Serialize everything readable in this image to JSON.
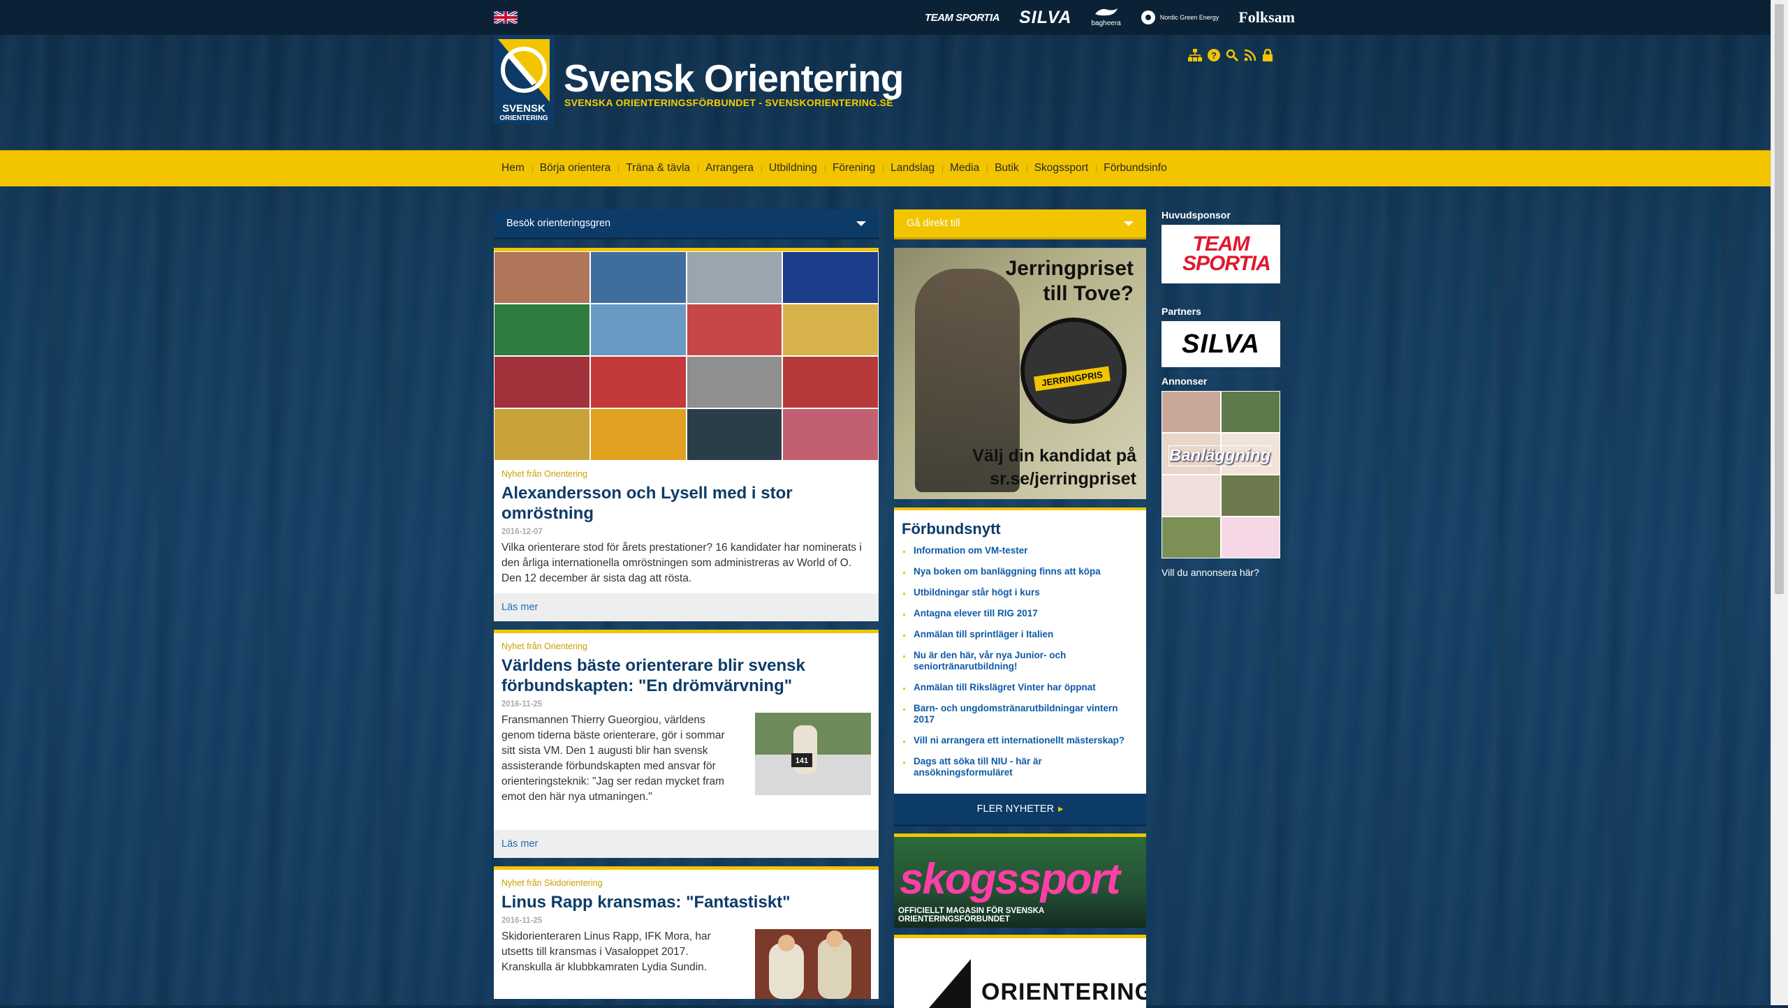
{
  "header": {
    "logo_title": "Svensk Orientering",
    "logo_subtitle": "SVENSKA ORIENTERINGSFÖRBUNDET - SVENSKORIENTERING.SE",
    "logo_box_text": "SVENSK ORIENTERING",
    "sponsors": [
      "TEAM SPORTIA",
      "SILVA",
      "bagheera",
      "Nordic Green Energy",
      "Folksam"
    ],
    "tools": [
      "sitemap-icon",
      "help-icon",
      "search-icon",
      "rss-icon",
      "lock-icon"
    ]
  },
  "nav": {
    "items": [
      "Hem",
      "Börja orientera",
      "Träna & tävla",
      "Arrangera",
      "Utbildning",
      "Förening",
      "Landslag",
      "Media",
      "Butik",
      "Skogssport",
      "Förbundsinfo"
    ]
  },
  "left": {
    "dropdown": "Besök orienteringsgren",
    "articles": [
      {
        "source": "Nyhet från Orientering",
        "title": "Alexandersson och Lysell med i stor omröstning",
        "date": "2016-12-07",
        "body": "Vilka orienterare stod för årets prestationer? 16 kandidater har nominerats i den årliga internationella omröstningen som administreras av World of O. Den 12 december är sista dag att rösta.",
        "more": "Läs mer"
      },
      {
        "source": "Nyhet från Orientering",
        "title": "Världens bäste orienterare blir svensk förbundskapten: \"En drömvärvning\"",
        "date": "2016-11-25",
        "body": "Fransmannen Thierry Gueorgiou, världens genom tiderna bäste orienterare, gör i sommar sitt sista VM. Den 1 augusti blir han svensk assisterande förbundskapten med ansvar för orienteringsteknik: \"Jag ser redan mycket fram emot den här nya utmaningen.\"",
        "more": "Läs mer"
      },
      {
        "source": "Nyhet från Skidorientering",
        "title": "Linus Rapp kransmas: \"Fantastiskt\"",
        "date": "2016-11-25",
        "body": "Skidorienteraren Linus Rapp, IFK Mora, har utsetts till kransmas i Vasaloppet 2017. Kranskulla är klubbkamraten Lydia Sundin."
      }
    ]
  },
  "middle": {
    "dropdown": "Gå direkt till",
    "banner": {
      "line1": "Jerringpriset",
      "line2": "till Tove?",
      "badge": "JERRINGPRIS",
      "line3": "Välj din kandidat på",
      "line4": "sr.se/jerringpriset"
    },
    "news": {
      "title": "Förbundsnytt",
      "items": [
        "Information om VM-tester",
        "Nya boken om banläggning finns att köpa",
        "Utbildningar står högt i kurs",
        "Antagna elever till RIG 2017",
        "Anmälan till sprintläger i Italien",
        "Nu är den här, vår nya Junior- och seniortränarutbildning!",
        "Anmälan till Rikslägret Vinter har öppnat",
        "Barn- och ungdomstränarutbildningar vintern 2017",
        "Vill ni arrangera ett internationellt mästerskap?",
        "Dags att söka till NIU - här är ansökningsformuläret"
      ],
      "more": "FLER NYHETER"
    },
    "skogssport": {
      "brand": "skogssport",
      "caption": "OFFICIELLT MAGASIN FÖR SVENSKA ORIENTERINGSFÖRBUNDET"
    },
    "orientering_se": "ORIENTERING.SE"
  },
  "right": {
    "main_sponsor_heading": "Huvudsponsor",
    "main_sponsor": "TEAM SPORTIA",
    "partners_heading": "Partners",
    "partner": "SILVA",
    "ads_heading": "Annonser",
    "ad_label": "Banläggning",
    "ad_link": "Vill du annonsera här?"
  },
  "colors": {
    "brand_blue": "#0d3b68",
    "brand_yellow": "#f2c500",
    "link_blue": "#0d5aa7"
  }
}
